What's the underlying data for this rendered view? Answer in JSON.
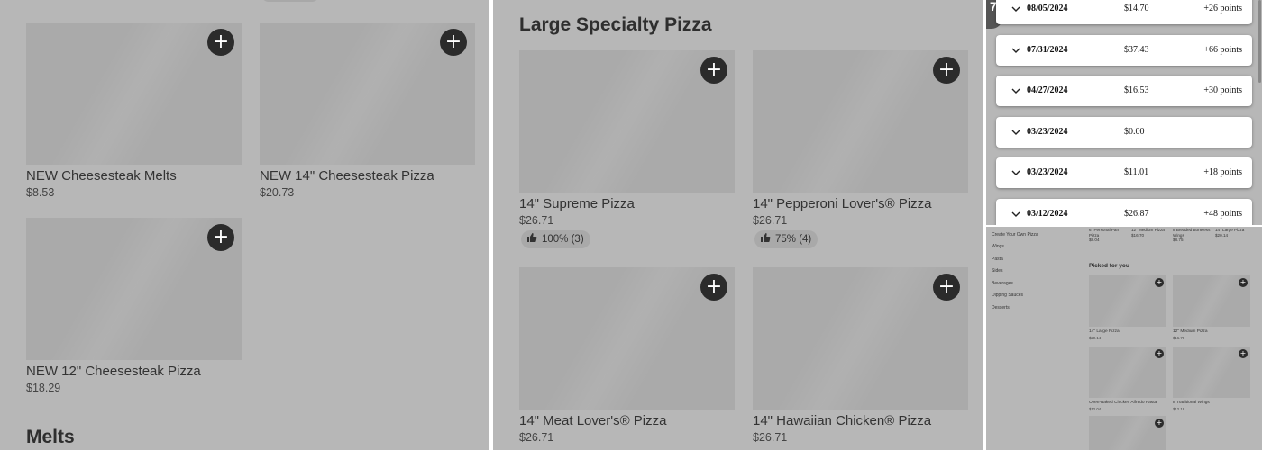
{
  "panel_a": {
    "cards": [
      {
        "name": "NEW Cheesesteak Melts",
        "price": "$8.53"
      },
      {
        "name": "NEW 14\" Cheesesteak Pizza",
        "price": "$20.73"
      },
      {
        "name": "NEW 12\" Cheesesteak Pizza",
        "price": "$18.29"
      }
    ],
    "next_section_title": "Melts"
  },
  "panel_b": {
    "section_title": "Large Specialty Pizza",
    "cards": [
      {
        "name": "14\" Supreme Pizza",
        "price": "$26.71",
        "rating": "100% (3)"
      },
      {
        "name": "14\" Pepperoni Lover's® Pizza",
        "price": "$26.71",
        "rating": "75% (4)"
      },
      {
        "name": "14\" Meat Lover's® Pizza",
        "price": "$26.71"
      },
      {
        "name": "14\" Hawaiian Chicken® Pizza",
        "price": "$26.71"
      }
    ]
  },
  "panel_c": {
    "corner_badge": "7",
    "orders": [
      {
        "date": "08/05/2024",
        "amount": "$14.70",
        "points": "+26 points"
      },
      {
        "date": "07/31/2024",
        "amount": "$37.43",
        "points": "+66 points"
      },
      {
        "date": "04/27/2024",
        "amount": "$16.53",
        "points": "+30 points"
      },
      {
        "date": "03/23/2024",
        "amount": "$0.00",
        "points": ""
      },
      {
        "date": "03/23/2024",
        "amount": "$11.01",
        "points": "+18 points"
      },
      {
        "date": "03/12/2024",
        "amount": "$26.87",
        "points": "+48 points"
      }
    ]
  },
  "panel_d": {
    "sidebar": [
      "Create Your Own Pizza",
      "Wings",
      "Pasta",
      "Sides",
      "Beverages",
      "Dipping Sauces",
      "Desserts"
    ],
    "top_items": [
      {
        "name": "6\" Personal Pan Pizza",
        "price": "$8.04"
      },
      {
        "name": "12\" Medium Pizza",
        "price": "$16.70"
      },
      {
        "name": "8 Breaded Boneless Wings",
        "price": "$8.75"
      },
      {
        "name": "14\" Large Pizza",
        "price": "$20.14"
      }
    ],
    "section_title": "Picked for you",
    "picked": [
      {
        "name": "14\" Large Pizza",
        "price": "$20.14"
      },
      {
        "name": "12\" Medium Pizza",
        "price": "$16.70"
      },
      {
        "name": "Oven-Baked Chicken Alfredo Pasta",
        "price": "$12.04"
      },
      {
        "name": "8 Traditional Wings",
        "price": "$12.19"
      },
      {
        "name": "",
        "price": ""
      }
    ]
  }
}
